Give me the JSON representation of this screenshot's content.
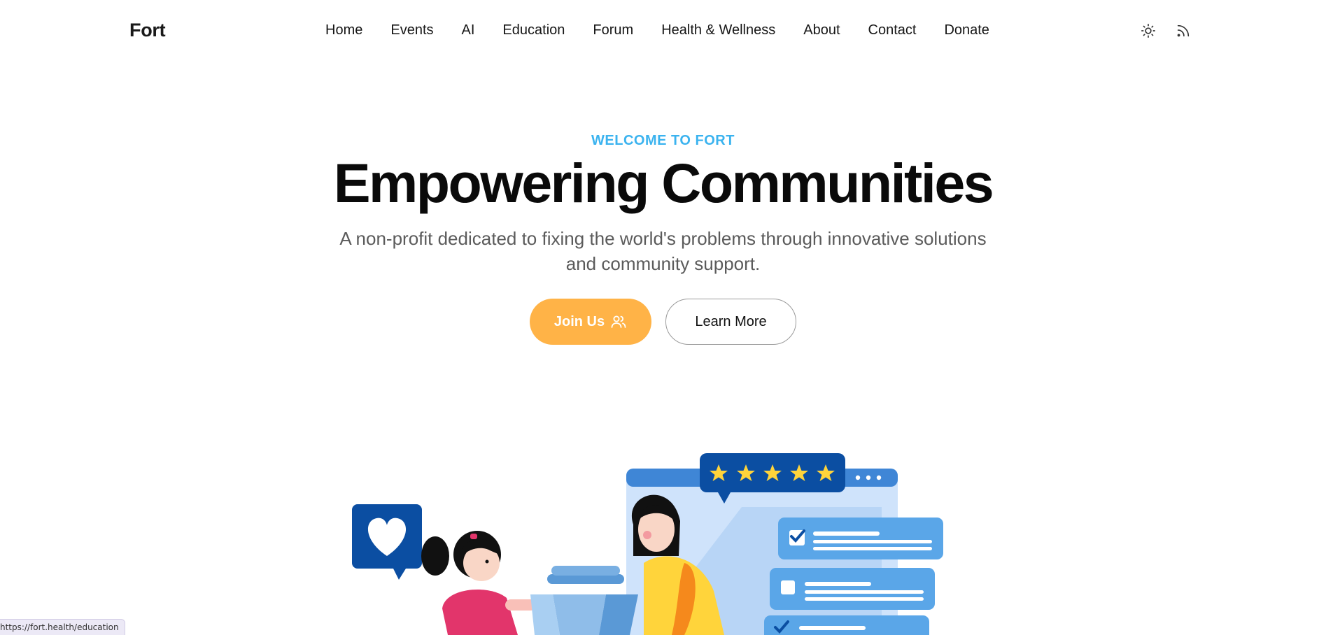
{
  "nav": {
    "brand": "Fort",
    "items": [
      {
        "label": "Home"
      },
      {
        "label": "Events"
      },
      {
        "label": "AI"
      },
      {
        "label": "Education"
      },
      {
        "label": "Forum"
      },
      {
        "label": "Health & Wellness"
      },
      {
        "label": "About"
      },
      {
        "label": "Contact"
      },
      {
        "label": "Donate"
      }
    ],
    "icons": [
      "sun-icon",
      "rss-icon"
    ]
  },
  "hero": {
    "eyebrow": "WELCOME TO FORT",
    "headline": "Empowering Communities",
    "subtitle": "A non-profit dedicated to fixing the world's problems through innovative solutions and community support.",
    "join_label": "Join Us",
    "learn_label": "Learn More"
  },
  "illustration": {
    "rating_stars": 5
  },
  "status_bar": {
    "url": "https://fort.health/education"
  },
  "colors": {
    "accent": "#3bb3ef",
    "join_button": "#ffb347",
    "illustration_blue": "#5aa6e8",
    "heart_badge": "#0b4ea2",
    "star": "#ffd43b"
  }
}
